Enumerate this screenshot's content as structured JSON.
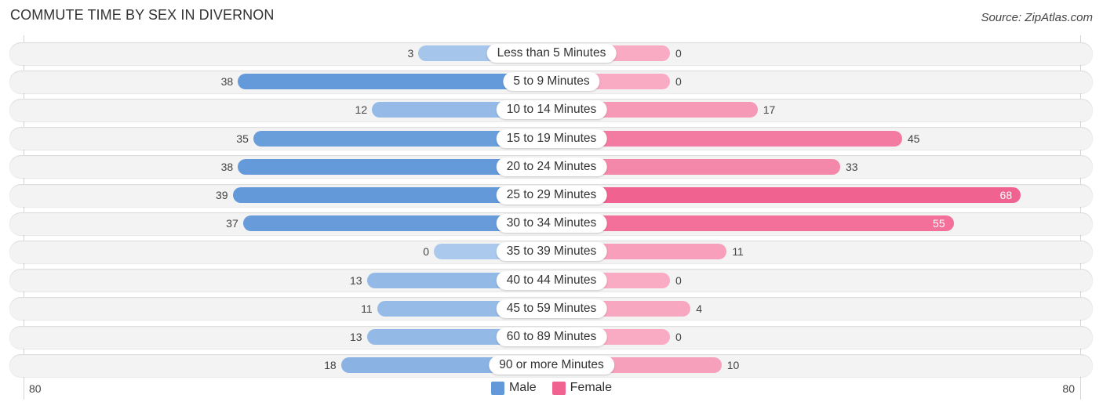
{
  "header": {
    "title": "COMMUTE TIME BY SEX IN DIVERNON",
    "source": "Source: ZipAtlas.com"
  },
  "chart_data": {
    "type": "bar",
    "orientation": "horizontal-diverging",
    "title": "COMMUTE TIME BY SEX IN DIVERNON",
    "source": "Source: ZipAtlas.com",
    "xlabel": "",
    "ylabel": "",
    "categories": [
      "Less than 5 Minutes",
      "5 to 9 Minutes",
      "10 to 14 Minutes",
      "15 to 19 Minutes",
      "20 to 24 Minutes",
      "25 to 29 Minutes",
      "30 to 34 Minutes",
      "35 to 39 Minutes",
      "40 to 44 Minutes",
      "45 to 59 Minutes",
      "60 to 89 Minutes",
      "90 or more Minutes"
    ],
    "series": [
      {
        "name": "Male",
        "side": "left",
        "values": [
          3,
          38,
          12,
          35,
          38,
          39,
          37,
          0,
          13,
          11,
          13,
          18
        ],
        "color": "#6399d9",
        "color_light": "#abc9ed"
      },
      {
        "name": "Female",
        "side": "right",
        "values": [
          0,
          0,
          17,
          45,
          33,
          68,
          55,
          11,
          0,
          4,
          0,
          10
        ],
        "color": "#f0628f",
        "color_light": "#f8abc3"
      }
    ],
    "axis": {
      "range": [
        0,
        80
      ],
      "left_label": "80",
      "right_label": "80"
    },
    "grid": true,
    "legend": {
      "position": "bottom-center",
      "items": [
        "Male",
        "Female"
      ]
    }
  }
}
